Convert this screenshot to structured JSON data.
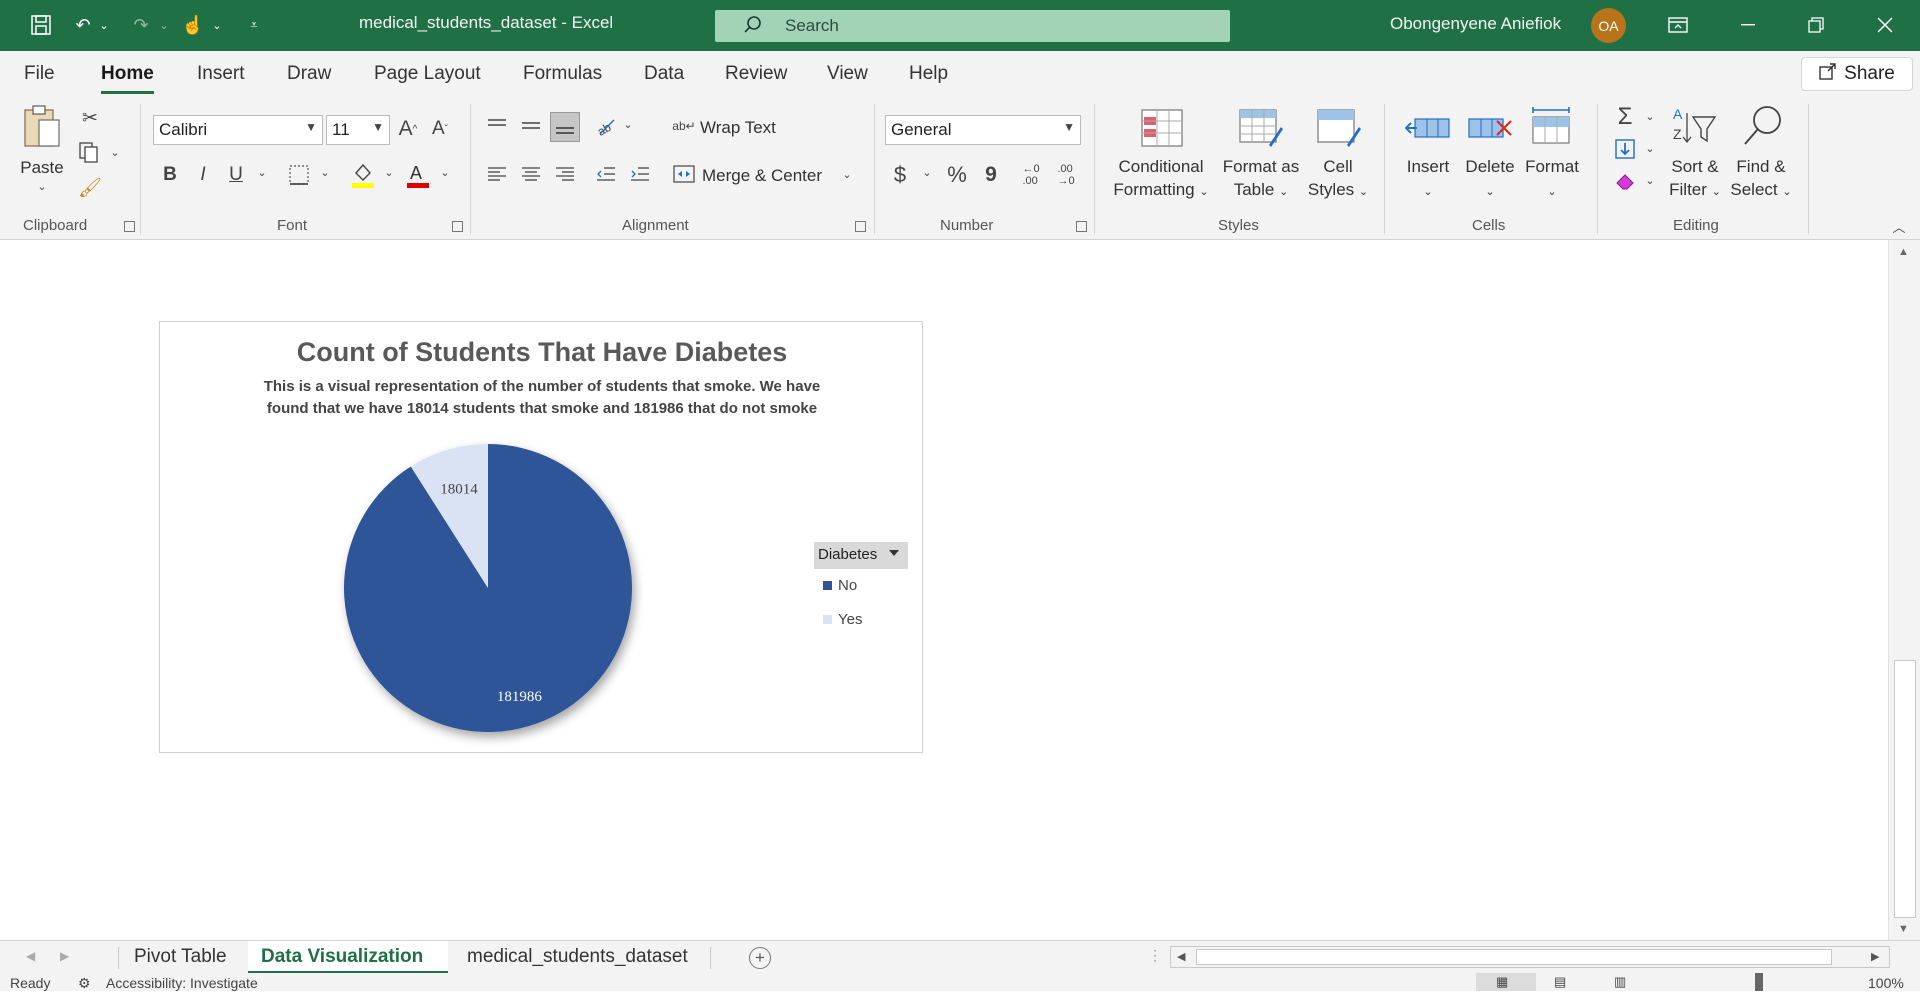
{
  "titlebar": {
    "doc_title": "medical_students_dataset  -  Excel",
    "search_placeholder": "Search",
    "user_name": "Obongenyene Aniefiok",
    "user_initials": "OA"
  },
  "menu": {
    "tabs": [
      "File",
      "Home",
      "Insert",
      "Draw",
      "Page Layout",
      "Formulas",
      "Data",
      "Review",
      "View",
      "Help"
    ],
    "active": "Home",
    "share_label": "Share"
  },
  "ribbon": {
    "clipboard": {
      "paste": "Paste",
      "group": "Clipboard"
    },
    "font": {
      "name": "Calibri",
      "size": "11",
      "bold": "B",
      "italic": "I",
      "underline": "U",
      "group": "Font"
    },
    "alignment": {
      "wrap": "Wrap Text",
      "merge": "Merge & Center",
      "group": "Alignment"
    },
    "number": {
      "format": "General",
      "currency": "$",
      "percent": "%",
      "comma": "9",
      "group": "Number"
    },
    "styles": {
      "conditional_1": "Conditional",
      "conditional_2": "Formatting",
      "format_table_1": "Format as",
      "format_table_2": "Table",
      "cell_styles_1": "Cell",
      "cell_styles_2": "Styles",
      "group": "Styles"
    },
    "cells": {
      "insert": "Insert",
      "delete": "Delete",
      "format": "Format",
      "group": "Cells"
    },
    "editing": {
      "sort_1": "Sort &",
      "sort_2": "Filter",
      "find_1": "Find &",
      "find_2": "Select",
      "group": "Editing"
    }
  },
  "chart_data": {
    "type": "pie",
    "title": "Count of Students That Have Diabetes",
    "subtitle_line1": "This is a visual representation of the number of students that smoke. We have",
    "subtitle_line2": "found that we have 18014 students that smoke and 181986 that do not smoke",
    "legend_title": "Diabetes",
    "categories": [
      "No",
      "Yes"
    ],
    "values": [
      181986,
      18014
    ],
    "data_labels": [
      "181986",
      "18014"
    ],
    "colors": [
      "#2f5597",
      "#dae3f3"
    ],
    "legend_position": "right"
  },
  "sheets": {
    "tabs": [
      "Pivot Table",
      "Data Visualization",
      "medical_students_dataset"
    ],
    "active": "Data Visualization"
  },
  "status": {
    "ready": "Ready",
    "accessibility": "Accessibility: Investigate",
    "zoom": "100%"
  }
}
